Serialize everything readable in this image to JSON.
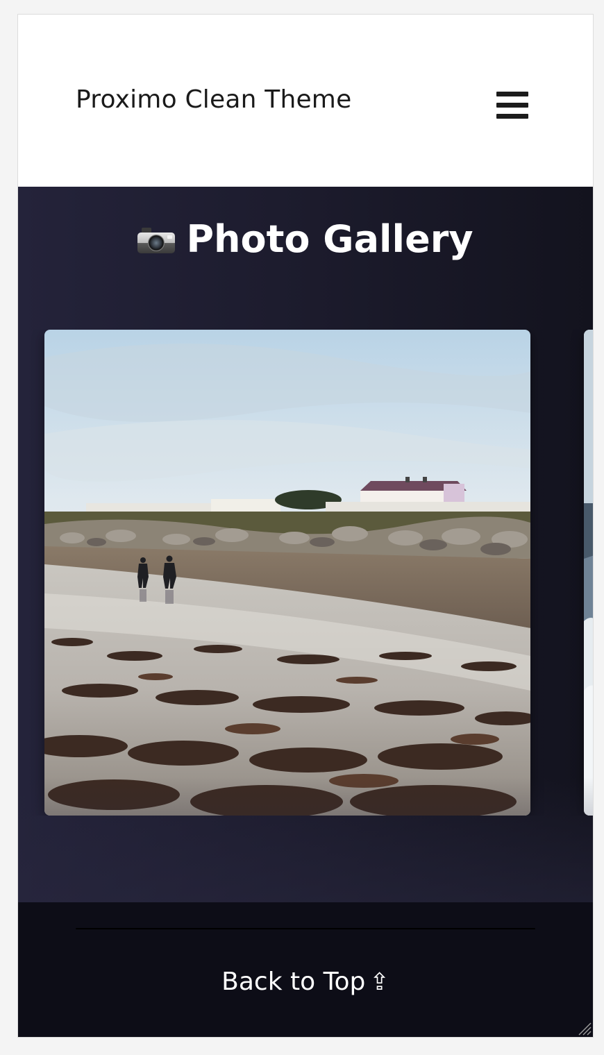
{
  "header": {
    "site_title": "Proximo Clean Theme",
    "menu_icon": "hamburger-menu-icon"
  },
  "gallery": {
    "heading_icon": "camera-icon",
    "heading": "Photo Gallery",
    "items": [
      {
        "image": "beach-seaweed-photo",
        "alt": ""
      },
      {
        "image": "sea-waves-photo",
        "alt": ""
      }
    ]
  },
  "footer": {
    "back_to_top": "Back to Top",
    "back_to_top_icon": "⇪"
  },
  "colors": {
    "header_bg": "#ffffff",
    "gallery_bg": "#1d1c2e",
    "footer_bg": "#0d0d17",
    "text_light": "#ffffff",
    "text_dark": "#1a1a1a"
  }
}
